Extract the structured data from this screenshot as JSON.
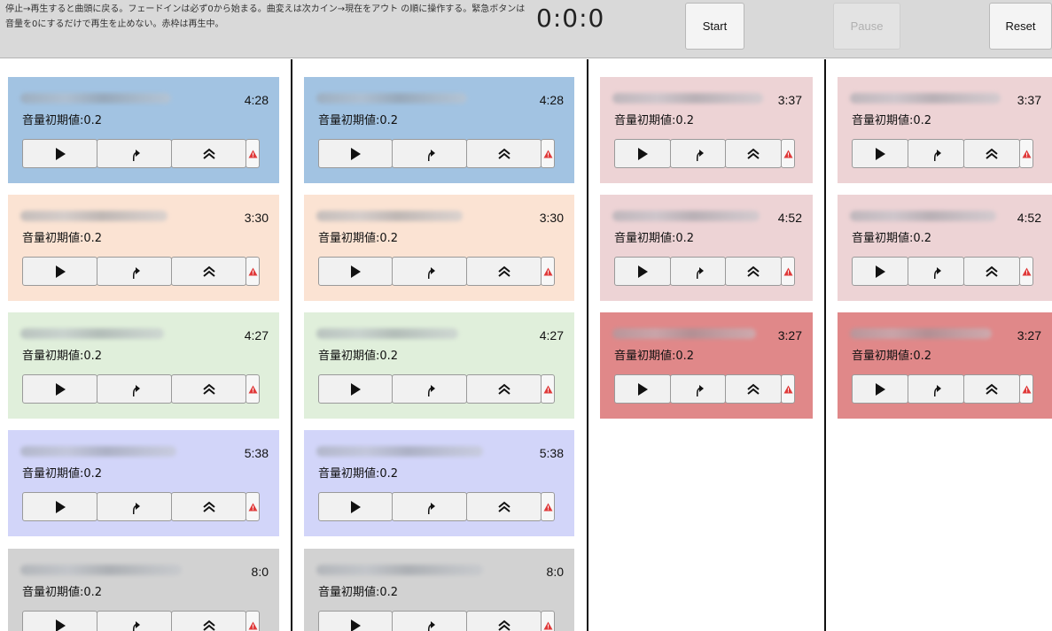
{
  "header": {
    "instructions": "停止→再生すると曲頭に戻る。フェードインは必ず0から始まる。曲変えは次カイン→現在をアウト の順に操作する。緊急ボタンは音量を0にするだけで再生を止めない。赤枠は再生中。",
    "clock": "0:0:0",
    "start_label": "Start",
    "pause_label": "Pause",
    "reset_label": "Reset"
  },
  "icons": {
    "play": "play-icon",
    "fade_in": "fade-in-icon",
    "fade_out": "fade-out-icon",
    "emergency": "warning-icon"
  },
  "colors": {
    "blue": "#a2c3e2",
    "peach": "#fbe3d3",
    "green": "#e0efdb",
    "lavender": "#d2d5f9",
    "gray": "#d2d2d2",
    "pink": "#edd3d5",
    "red": "#e08889",
    "warning_red": "#e03a3a"
  },
  "columns": [
    {
      "cards": [
        {
          "duration": "4:28",
          "volume_label": "音量初期値:0.2",
          "color": "#a2c3e2"
        },
        {
          "duration": "3:30",
          "volume_label": "音量初期値:0.2",
          "color": "#fbe3d3"
        },
        {
          "duration": "4:27",
          "volume_label": "音量初期値:0.2",
          "color": "#e0efdb"
        },
        {
          "duration": "5:38",
          "volume_label": "音量初期値:0.2",
          "color": "#d2d5f9"
        },
        {
          "duration": "8:0",
          "volume_label": "音量初期値:0.2",
          "color": "#d2d2d2"
        }
      ]
    },
    {
      "cards": [
        {
          "duration": "4:28",
          "volume_label": "音量初期値:0.2",
          "color": "#a2c3e2"
        },
        {
          "duration": "3:30",
          "volume_label": "音量初期値:0.2",
          "color": "#fbe3d3"
        },
        {
          "duration": "4:27",
          "volume_label": "音量初期値:0.2",
          "color": "#e0efdb"
        },
        {
          "duration": "5:38",
          "volume_label": "音量初期値:0.2",
          "color": "#d2d5f9"
        },
        {
          "duration": "8:0",
          "volume_label": "音量初期値:0.2",
          "color": "#d2d2d2"
        }
      ]
    },
    {
      "cards": [
        {
          "duration": "3:37",
          "volume_label": "音量初期値:0.2",
          "color": "#edd3d5"
        },
        {
          "duration": "4:52",
          "volume_label": "音量初期値:0.2",
          "color": "#edd3d5"
        },
        {
          "duration": "3:27",
          "volume_label": "音量初期値:0.2",
          "color": "#e08889"
        }
      ]
    },
    {
      "cards": [
        {
          "duration": "3:37",
          "volume_label": "音量初期値:0.2",
          "color": "#edd3d5"
        },
        {
          "duration": "4:52",
          "volume_label": "音量初期値:0.2",
          "color": "#edd3d5"
        },
        {
          "duration": "3:27",
          "volume_label": "音量初期値:0.2",
          "color": "#e08889"
        }
      ]
    }
  ]
}
